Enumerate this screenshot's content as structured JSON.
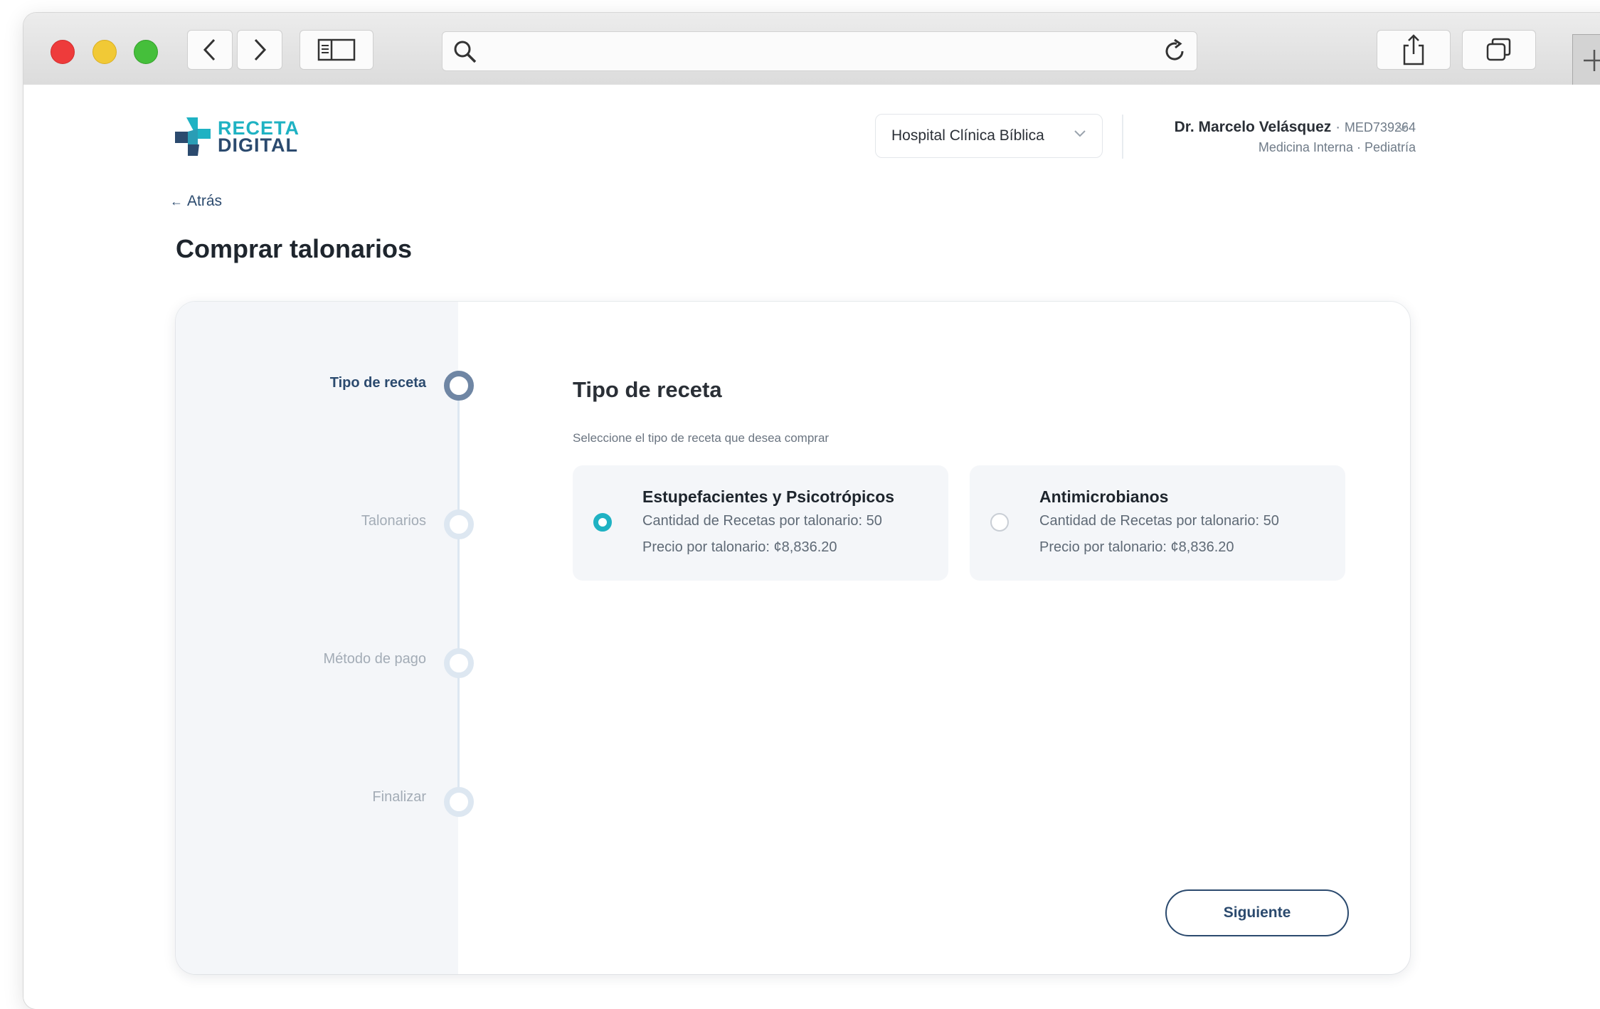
{
  "browser": {
    "icons": [
      "back-icon",
      "forward-icon",
      "sidebar-icon",
      "search-icon",
      "reload-icon",
      "share-icon",
      "tabs-icon",
      "new-tab-icon"
    ]
  },
  "brand": {
    "line1": "RECETA",
    "line2": "DIGITAL",
    "colors": {
      "teal": "#1fb2c3",
      "navy": "#2b4a6e"
    }
  },
  "header": {
    "hospital": "Hospital Clínica Bíblica",
    "doctor_name": "Dr. Marcelo Velásquez",
    "separator": " · ",
    "doctor_code": "MED739264",
    "specialties": "Medicina Interna · Pediatría"
  },
  "nav": {
    "back_label": "Atrás"
  },
  "page": {
    "title": "Comprar talonarios"
  },
  "steps": [
    {
      "label": "Tipo de receta",
      "active": true
    },
    {
      "label": "Talonarios",
      "active": false
    },
    {
      "label": "Método de pago",
      "active": false
    },
    {
      "label": "Finalizar",
      "active": false
    }
  ],
  "section": {
    "title": "Tipo de receta",
    "subtitle": "Seleccione el tipo de receta que desea comprar"
  },
  "options": [
    {
      "title": "Estupefacientes y Psicotrópicos",
      "qty": "Cantidad de Recetas por talonario: 50",
      "price": "Precio por talonario: ¢8,836.20",
      "selected": true
    },
    {
      "title": "Antimicrobianos",
      "qty": "Cantidad de Recetas por talonario: 50",
      "price": "Precio por talonario: ¢8,836.20",
      "selected": false
    }
  ],
  "actions": {
    "next_label": "Siguiente"
  }
}
